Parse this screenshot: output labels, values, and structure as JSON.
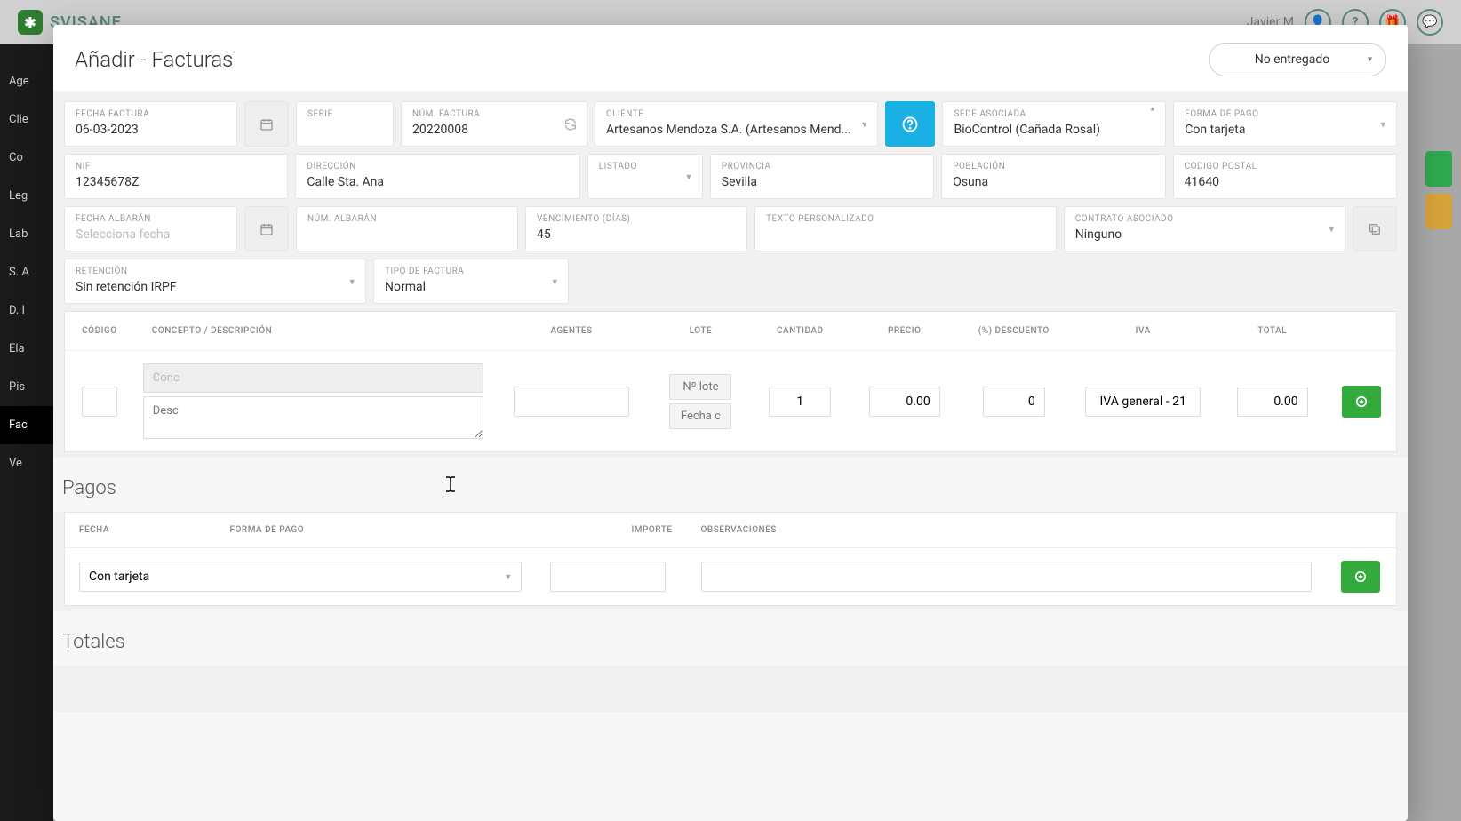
{
  "topbar": {
    "brand": "SVISANE",
    "username": "Javier M"
  },
  "sidebar": {
    "items": [
      "Age",
      "Clie",
      "Co",
      "Leg",
      "Lab",
      "S. A",
      "D. I",
      "Ela",
      "Pis",
      "Fac",
      "Ve"
    ]
  },
  "modal": {
    "title": "Añadir - Facturas",
    "status": "No entregado"
  },
  "fields": {
    "fecha_factura": {
      "label": "FECHA FACTURA",
      "value": "06-03-2023"
    },
    "serie": {
      "label": "SERIE",
      "value": ""
    },
    "num_factura": {
      "label": "NÚM. FACTURA",
      "value": "20220008"
    },
    "cliente": {
      "label": "CLIENTE",
      "value": "Artesanos Mendoza S.A. (Artesanos Mend..."
    },
    "sede": {
      "label": "SEDE ASOCIADA",
      "value": "BioControl (Cañada Rosal)"
    },
    "forma_pago": {
      "label": "FORMA DE PAGO",
      "value": "Con tarjeta"
    },
    "nif": {
      "label": "NIF",
      "value": "12345678Z"
    },
    "direccion": {
      "label": "DIRECCIÓN",
      "value": "Calle Sta. Ana"
    },
    "listado": {
      "label": "LISTADO",
      "value": ""
    },
    "provincia": {
      "label": "PROVINCIA",
      "value": "Sevilla"
    },
    "poblacion": {
      "label": "POBLACIÓN",
      "value": "Osuna"
    },
    "cp": {
      "label": "CÓDIGO POSTAL",
      "value": "41640"
    },
    "fecha_albaran": {
      "label": "FECHA ALBARÁN",
      "placeholder": "Selecciona fecha"
    },
    "num_albaran": {
      "label": "NÚM. ALBARÁN",
      "value": ""
    },
    "vencimiento": {
      "label": "VENCIMIENTO (DÍAS)",
      "value": "45"
    },
    "texto_pers": {
      "label": "TEXTO PERSONALIZADO",
      "value": ""
    },
    "contrato": {
      "label": "CONTRATO ASOCIADO",
      "value": "Ninguno"
    },
    "retencion": {
      "label": "RETENCIÓN",
      "value": "Sin retención IRPF"
    },
    "tipo_factura": {
      "label": "TIPO DE FACTURA",
      "value": "Normal"
    }
  },
  "line_table": {
    "headers": {
      "codigo": "CÓDIGO",
      "concepto": "CONCEPTO / DESCRIPCIÓN",
      "agentes": "AGENTES",
      "lote": "LOTE",
      "cantidad": "CANTIDAD",
      "precio": "PRECIO",
      "descuento": "(%) DESCUENTO",
      "iva": "IVA",
      "total": "TOTAL"
    },
    "row": {
      "concepto_ph": "Conc",
      "descripcion_ph": "Desc",
      "lote_ph": "Nº lote",
      "fecha_ph": "Fecha c",
      "cantidad": "1",
      "precio": "0.00",
      "descuento": "0",
      "iva": "IVA general - 21",
      "total": "0.00"
    }
  },
  "pagos": {
    "title": "Pagos",
    "headers": {
      "fecha": "FECHA",
      "forma": "FORMA DE PAGO",
      "importe": "IMPORTE",
      "observaciones": "OBSERVACIONES"
    },
    "row": {
      "forma": "Con tarjeta"
    }
  },
  "totales": {
    "title": "Totales"
  }
}
